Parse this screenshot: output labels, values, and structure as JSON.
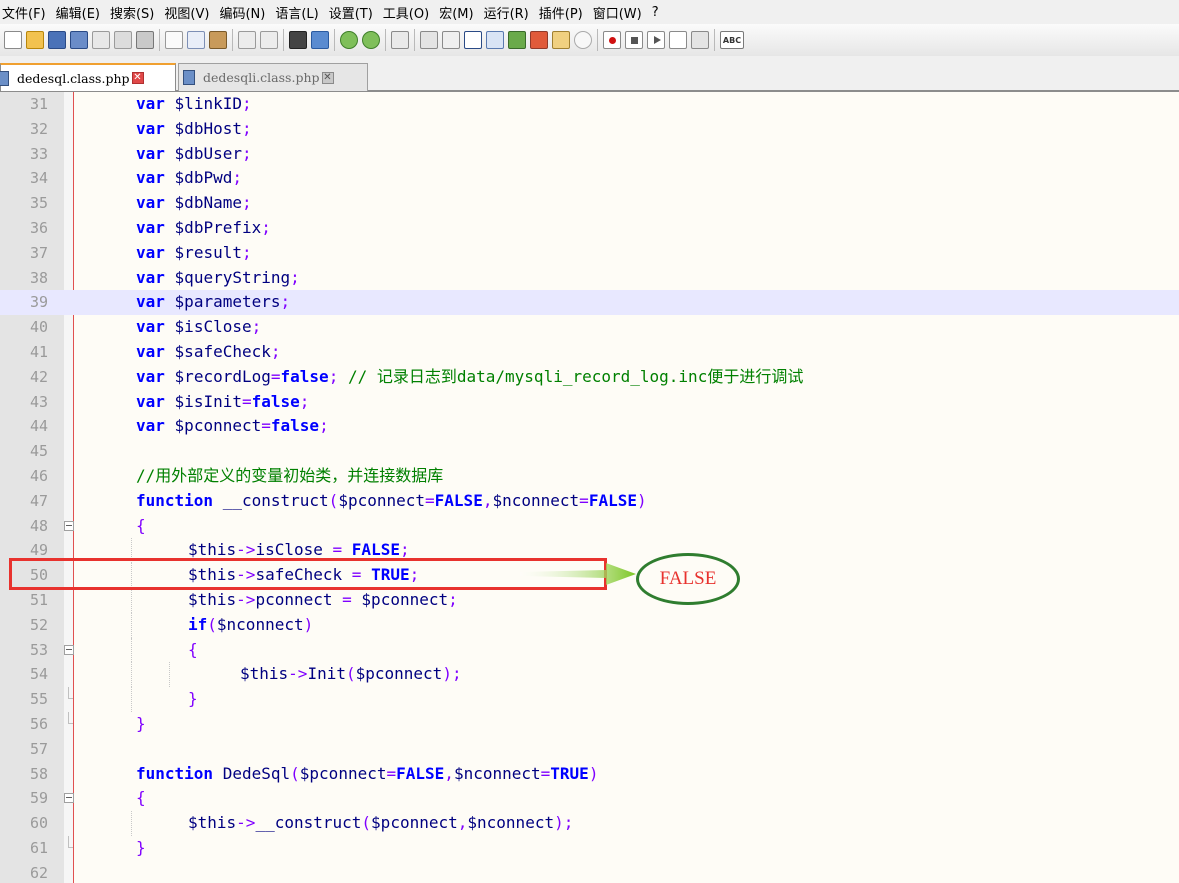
{
  "menu": [
    "文件(F)",
    "编辑(E)",
    "搜索(S)",
    "视图(V)",
    "编码(N)",
    "语言(L)",
    "设置(T)",
    "工具(O)",
    "宏(M)",
    "运行(R)",
    "插件(P)",
    "窗口(W)",
    "?"
  ],
  "toolbar": {
    "icons": [
      "new-file-icon",
      "open-file-icon",
      "save-icon",
      "save-all-icon",
      "close-icon",
      "close-all-icon",
      "print-icon",
      "cut-icon",
      "copy-icon",
      "paste-icon",
      "undo-icon",
      "redo-icon",
      "find-icon",
      "replace-icon",
      "zoom-in-icon",
      "zoom-out-icon",
      "sync-scroll-icon",
      "word-wrap-icon",
      "show-all-chars-icon",
      "indent-guide-icon",
      "user-language-icon",
      "document-map-icon",
      "function-list-icon",
      "folder-workspace-icon",
      "monitoring-icon",
      "record-macro-icon",
      "stop-macro-icon",
      "play-macro-icon",
      "play-macro-multiple-icon",
      "save-macro-icon",
      "spell-check-icon"
    ],
    "spell_label": "ABC"
  },
  "tabs": [
    {
      "label": "dedesql.class.php",
      "active": true
    },
    {
      "label": "dedesqli.class.php",
      "active": false
    }
  ],
  "tab_close_glyph": "✕",
  "editor": {
    "current_line": 39,
    "lines": [
      {
        "n": "31",
        "code": "var $linkID;"
      },
      {
        "n": "32",
        "code": "var $dbHost;"
      },
      {
        "n": "33",
        "code": "var $dbUser;"
      },
      {
        "n": "34",
        "code": "var $dbPwd;"
      },
      {
        "n": "35",
        "code": "var $dbName;"
      },
      {
        "n": "36",
        "code": "var $dbPrefix;"
      },
      {
        "n": "37",
        "code": "var $result;"
      },
      {
        "n": "38",
        "code": "var $queryString;"
      },
      {
        "n": "39",
        "code": "var $parameters;"
      },
      {
        "n": "40",
        "code": "var $isClose;"
      },
      {
        "n": "41",
        "code": "var $safeCheck;"
      },
      {
        "n": "42",
        "code": "var $recordLog=false; // 记录日志到data/mysqli_record_log.inc便于进行调试"
      },
      {
        "n": "43",
        "code": "var $isInit=false;"
      },
      {
        "n": "44",
        "code": "var $pconnect=false;"
      },
      {
        "n": "45",
        "code": ""
      },
      {
        "n": "46",
        "code": "//用外部定义的变量初始类，并连接数据库"
      },
      {
        "n": "47",
        "code": "function __construct($pconnect=FALSE,$nconnect=FALSE)"
      },
      {
        "n": "48",
        "code": "{"
      },
      {
        "n": "49",
        "code": "$this->isClose = FALSE;"
      },
      {
        "n": "50",
        "code": "$this->safeCheck = TRUE;"
      },
      {
        "n": "51",
        "code": "$this->pconnect = $pconnect;"
      },
      {
        "n": "52",
        "code": "if($nconnect)"
      },
      {
        "n": "53",
        "code": "{"
      },
      {
        "n": "54",
        "code": "$this->Init($pconnect);"
      },
      {
        "n": "55",
        "code": "}"
      },
      {
        "n": "56",
        "code": "}"
      },
      {
        "n": "57",
        "code": ""
      },
      {
        "n": "58",
        "code": "function DedeSql($pconnect=FALSE,$nconnect=TRUE)"
      },
      {
        "n": "59",
        "code": "{"
      },
      {
        "n": "60",
        "code": "$this->__construct($pconnect,$nconnect);"
      },
      {
        "n": "61",
        "code": "}"
      },
      {
        "n": "62",
        "code": ""
      }
    ]
  },
  "annotation": {
    "label": "FALSE",
    "box_color": "#e8322e",
    "arrow_color": "#7cc624",
    "oval_color": "#2f7d2f"
  }
}
